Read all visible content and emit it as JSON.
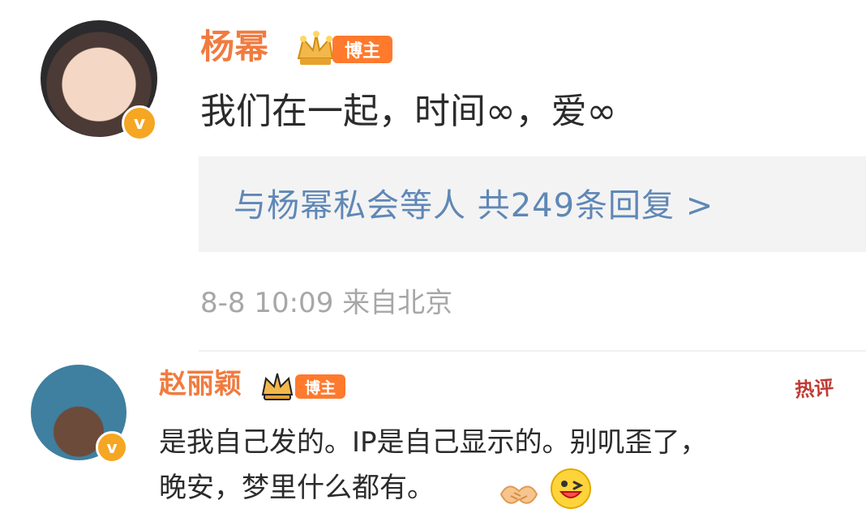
{
  "post": {
    "author": {
      "name": "杨幂",
      "badge": "博主",
      "avatar": "child-photo",
      "verified_icon": "v"
    },
    "content": "我们在一起，时间∞，爱∞",
    "replies_summary": "与杨幂私会等人  共249条回复 >",
    "meta": "8-8 10:09  来自北京"
  },
  "reply": {
    "author": {
      "name": "赵丽颖",
      "badge": "博主",
      "avatar": "beaver-photo",
      "verified_icon": "v"
    },
    "hot_label": "热评",
    "content_lines": [
      "是我自己发的。IP是自己显示的。别叽歪了，",
      "晚安，梦里什么都有。"
    ],
    "emojis": [
      "handshake-icon",
      "grin-face-icon"
    ]
  },
  "colors": {
    "name": "#f07b3f",
    "badge_bg": "#ff7a2d",
    "link": "#5f87b6",
    "meta": "#a7a7a7",
    "hot": "#c23a33",
    "reply_box_bg": "#f3f3f3"
  }
}
